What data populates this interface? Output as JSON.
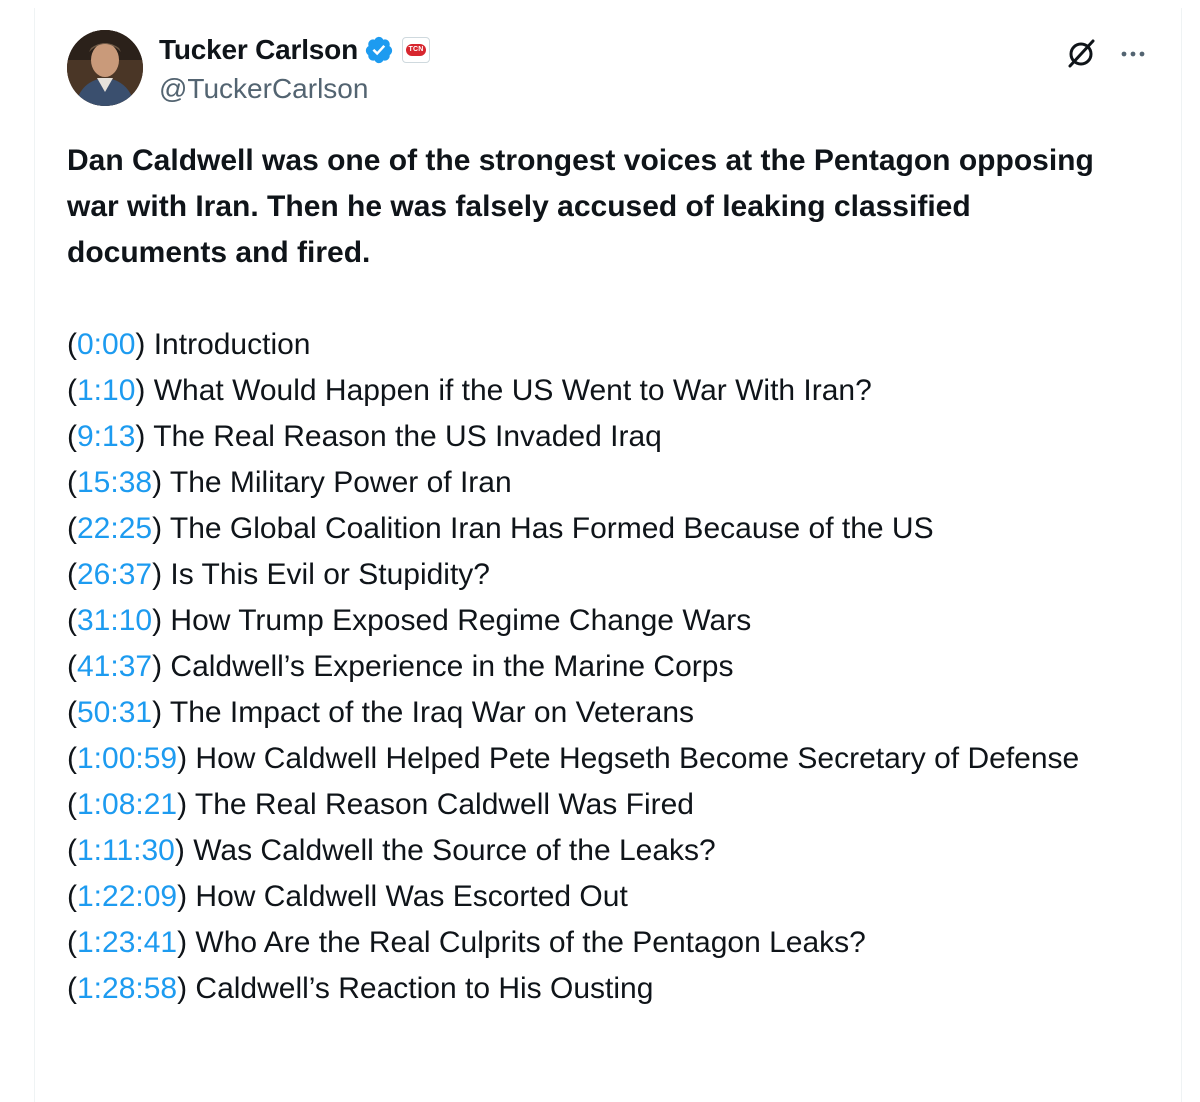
{
  "author": {
    "name": "Tucker Carlson",
    "handle": "@TuckerCarlson",
    "org_badge": "TCN",
    "verified_color": "#1d9bf0"
  },
  "actions": {
    "grok_icon": "grok-icon",
    "more_icon": "more-icon"
  },
  "post": {
    "lead": "Dan Caldwell was one of the strongest voices at the Pentagon opposing war with Iran. Then he was falsely accused of leaking classified documents and fired.",
    "chapters": [
      {
        "time": "0:00",
        "title": "Introduction"
      },
      {
        "time": "1:10",
        "title": "What Would Happen if the US Went to War With Iran?"
      },
      {
        "time": "9:13",
        "title": "The Real Reason the US Invaded Iraq"
      },
      {
        "time": "15:38",
        "title": "The Military Power of Iran"
      },
      {
        "time": "22:25",
        "title": "The Global Coalition Iran Has Formed Because of the US"
      },
      {
        "time": "26:37",
        "title": "Is This Evil or Stupidity?"
      },
      {
        "time": "31:10",
        "title": "How Trump Exposed Regime Change Wars"
      },
      {
        "time": "41:37",
        "title": "Caldwell’s Experience in the Marine Corps"
      },
      {
        "time": "50:31",
        "title": "The Impact of the Iraq War on Veterans"
      },
      {
        "time": "1:00:59",
        "title": "How Caldwell Helped Pete Hegseth Become Secretary of Defense"
      },
      {
        "time": "1:08:21",
        "title": "The Real Reason Caldwell Was Fired"
      },
      {
        "time": "1:11:30",
        "title": "Was Caldwell the Source of the Leaks?"
      },
      {
        "time": "1:22:09",
        "title": "How Caldwell Was Escorted Out"
      },
      {
        "time": "1:23:41",
        "title": "Who Are the Real Culprits of the Pentagon Leaks?"
      },
      {
        "time": "1:28:58",
        "title": "Caldwell’s Reaction to His Ousting"
      }
    ]
  },
  "colors": {
    "link": "#1d9bf0",
    "text": "#0f1419",
    "secondary": "#536471"
  }
}
